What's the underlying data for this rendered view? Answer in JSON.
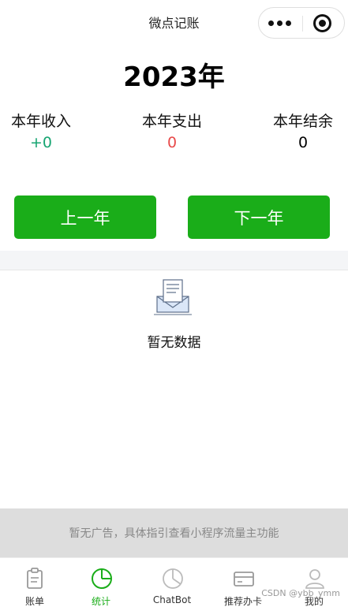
{
  "header": {
    "title": "微点记账"
  },
  "year": "2023年",
  "stats": {
    "income": {
      "label": "本年收入",
      "value": "+0"
    },
    "expense": {
      "label": "本年支出",
      "value": "0"
    },
    "balance": {
      "label": "本年结余",
      "value": "0"
    }
  },
  "buttons": {
    "prev": "上一年",
    "next": "下一年"
  },
  "empty": {
    "text": "暂无数据"
  },
  "ad": {
    "text": "暂无广告，具体指引查看小程序流量主功能"
  },
  "tabs": [
    {
      "label": "账单",
      "icon": "clipboard-icon",
      "active": false
    },
    {
      "label": "统计",
      "icon": "pie-chart-icon",
      "active": true
    },
    {
      "label": "ChatBot",
      "icon": "pie-outline-icon",
      "active": false
    },
    {
      "label": "推荐办卡",
      "icon": "credit-card-icon",
      "active": false
    },
    {
      "label": "我的",
      "icon": "user-icon",
      "active": false
    }
  ],
  "watermark": "CSDN @ybb_ymm",
  "colors": {
    "accent": "#1aad19",
    "income": "#17a572",
    "expense": "#e84a4a"
  }
}
